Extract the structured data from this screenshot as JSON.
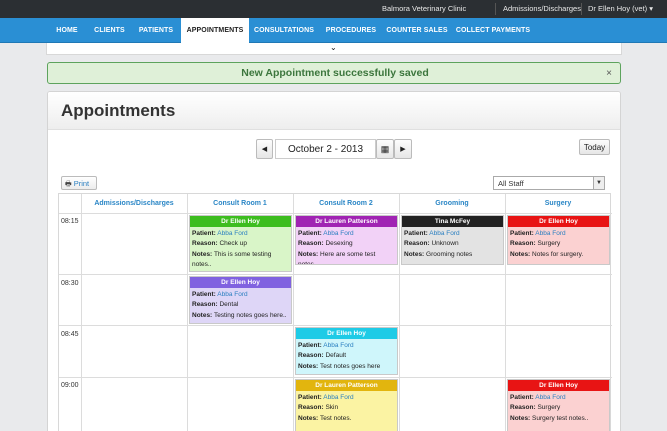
{
  "topbar": {
    "clinic": "Balmora Veterinary Clinic",
    "admissions": "Admissions/Discharges",
    "user": "Dr Ellen Hoy (vet)",
    "user_caret": "▾"
  },
  "nav": {
    "items": [
      {
        "label": "HOME"
      },
      {
        "label": "CLIENTS"
      },
      {
        "label": "PATIENTS"
      },
      {
        "label": "APPOINTMENTS"
      },
      {
        "label": "CONSULTATIONS"
      },
      {
        "label": "PROCEDURES"
      },
      {
        "label": "COUNTER SALES"
      },
      {
        "label": "COLLECT PAYMENTS"
      }
    ],
    "active": "APPOINTMENTS"
  },
  "collapse_chevron": "⌄",
  "alert": {
    "message": "New Appointment successfully saved",
    "close": "×"
  },
  "page": {
    "title": "Appointments"
  },
  "date_nav": {
    "prev": "◀",
    "date": "October 2 - 2013",
    "calendar": "▦",
    "next": "▶",
    "today": "Today"
  },
  "toolbar": {
    "print": "Print",
    "print_icon": "🖶",
    "staff_selected": "All Staff",
    "staff_caret": "▼"
  },
  "schedule": {
    "columns": [
      "Admissions/Discharges",
      "Consult Room 1",
      "Consult Room 2",
      "Grooming",
      "Surgery"
    ],
    "times": [
      "08:15",
      "08:30",
      "08:45",
      "09:00"
    ],
    "labels": {
      "patient": "Patient:",
      "reason": "Reason:",
      "notes": "Notes:"
    },
    "appointments": [
      {
        "staff": "Dr Ellen Hoy",
        "header_color": "#3dbd1f",
        "body_color": "#d9f5c8",
        "patient": "Abba Ford",
        "reason": "Check up",
        "notes": "This is some testing notes.."
      },
      {
        "staff": "Dr Lauren Patterson",
        "header_color": "#a024b3",
        "body_color": "#f2d2f7",
        "patient": "Abba Ford",
        "reason": "Desexing",
        "notes": "Here are some test notes.."
      },
      {
        "staff": "Tina McFey",
        "header_color": "#222222",
        "body_color": "#e3e3e3",
        "patient": "Abba Ford",
        "reason": "Unknown",
        "notes": "Grooming notes"
      },
      {
        "staff": "Dr Ellen Hoy",
        "header_color": "#e81414",
        "body_color": "#fbd1d1",
        "patient": "Abba Ford",
        "reason": "Surgery",
        "notes": "Notes for surgery."
      },
      {
        "staff": "Dr Ellen Hoy",
        "header_color": "#8062e0",
        "body_color": "#ded6f7",
        "patient": "Abba Ford",
        "reason": "Dental",
        "notes": "Testing notes goes here.."
      },
      {
        "staff": "Dr Ellen Hoy",
        "header_color": "#1ecbe6",
        "body_color": "#cff6fb",
        "patient": "Abba Ford",
        "reason": "Default",
        "notes": "Test notes goes here"
      },
      {
        "staff": "Dr Lauren Patterson",
        "header_color": "#e2b50e",
        "body_color": "#fbf3a3",
        "patient": "Abba Ford",
        "reason": "Skin",
        "notes": "Test notes."
      },
      {
        "staff": "Dr Ellen Hoy",
        "header_color": "#e81414",
        "body_color": "#fbd1d1",
        "patient": "Abba Ford",
        "reason": "Surgery",
        "notes": "Surgery test notes.."
      }
    ]
  }
}
